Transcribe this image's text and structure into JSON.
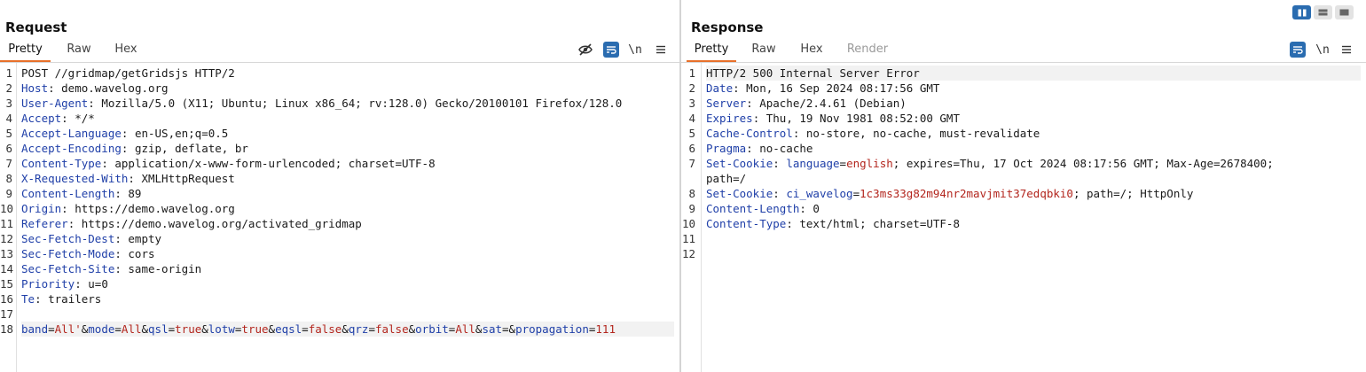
{
  "request": {
    "title": "Request",
    "tabs": [
      "Pretty",
      "Raw",
      "Hex"
    ],
    "active_tab": "Pretty",
    "toolbar": {
      "hide_icon": "eye-off-icon",
      "wrap_icon": "word-wrap-icon",
      "newline_label": "\\n",
      "menu_icon": "hamburger-menu-icon"
    },
    "lines": [
      {
        "n": "1",
        "text": "POST //gridmap/getGridsjs HTTP/2"
      },
      {
        "n": "2",
        "key": "Host",
        "val": " demo.wavelog.org"
      },
      {
        "n": "3",
        "key": "User-Agent",
        "val": " Mozilla/5.0 (X11; Ubuntu; Linux x86_64; rv:128.0) Gecko/20100101 Firefox/128.0"
      },
      {
        "n": "4",
        "key": "Accept",
        "val": " */*"
      },
      {
        "n": "5",
        "key": "Accept-Language",
        "val": " en-US,en;q=0.5"
      },
      {
        "n": "6",
        "key": "Accept-Encoding",
        "val": " gzip, deflate, br"
      },
      {
        "n": "7",
        "key": "Content-Type",
        "val": " application/x-www-form-urlencoded; charset=UTF-8"
      },
      {
        "n": "8",
        "key": "X-Requested-With",
        "val": " XMLHttpRequest"
      },
      {
        "n": "9",
        "key": "Content-Length",
        "val": " 89"
      },
      {
        "n": "10",
        "key": "Origin",
        "val": " https://demo.wavelog.org"
      },
      {
        "n": "11",
        "key": "Referer",
        "val": " https://demo.wavelog.org/activated_gridmap"
      },
      {
        "n": "12",
        "key": "Sec-Fetch-Dest",
        "val": " empty"
      },
      {
        "n": "13",
        "key": "Sec-Fetch-Mode",
        "val": " cors"
      },
      {
        "n": "14",
        "key": "Sec-Fetch-Site",
        "val": " same-origin"
      },
      {
        "n": "15",
        "key": "Priority",
        "val": " u=0"
      },
      {
        "n": "16",
        "key": "Te",
        "val": " trailers"
      },
      {
        "n": "17",
        "text": ""
      },
      {
        "n": "18",
        "highlight": true,
        "params": [
          {
            "k": "band",
            "v": "All'"
          },
          {
            "k": "mode",
            "v": "All"
          },
          {
            "k": "qsl",
            "v": "true"
          },
          {
            "k": "lotw",
            "v": "true"
          },
          {
            "k": "eqsl",
            "v": "false"
          },
          {
            "k": "qrz",
            "v": "false"
          },
          {
            "k": "orbit",
            "v": "All"
          },
          {
            "k": "sat",
            "v": ""
          },
          {
            "k": "propagation",
            "v": "111"
          }
        ]
      }
    ]
  },
  "response": {
    "title": "Response",
    "tabs": [
      "Pretty",
      "Raw",
      "Hex",
      "Render"
    ],
    "active_tab": "Pretty",
    "toolbar": {
      "wrap_icon": "word-wrap-icon",
      "newline_label": "\\n",
      "menu_icon": "hamburger-menu-icon"
    },
    "lines": [
      {
        "n": "1",
        "text": "HTTP/2 500 Internal Server Error",
        "highlight": true
      },
      {
        "n": "2",
        "key": "Date",
        "val": " Mon, 16 Sep 2024 08:17:56 GMT"
      },
      {
        "n": "3",
        "key": "Server",
        "val": " Apache/2.4.61 (Debian)"
      },
      {
        "n": "4",
        "key": "Expires",
        "val": " Thu, 19 Nov 1981 08:52:00 GMT"
      },
      {
        "n": "5",
        "key": "Cache-Control",
        "val": " no-store, no-cache, must-revalidate"
      },
      {
        "n": "6",
        "key": "Pragma",
        "val": " no-cache"
      },
      {
        "n": "7",
        "key": "Set-Cookie",
        "cookie_name": "language",
        "cookie_val": "english",
        "rest": "; expires=Thu, 17 Oct 2024 08:17:56 GMT; Max-Age=2678400;"
      },
      {
        "n": "",
        "text": "path=/"
      },
      {
        "n": "8",
        "key": "Set-Cookie",
        "cookie_name": "ci_wavelog",
        "cookie_val": "1c3ms33g82m94nr2mavjmit37edqbki0",
        "rest": "; path=/; HttpOnly"
      },
      {
        "n": "9",
        "key": "Content-Length",
        "val": " 0"
      },
      {
        "n": "10",
        "key": "Content-Type",
        "val": " text/html; charset=UTF-8"
      },
      {
        "n": "11",
        "text": ""
      },
      {
        "n": "12",
        "text": ""
      }
    ]
  },
  "layout_buttons": [
    {
      "name": "side-by-side-layout-icon",
      "active": true
    },
    {
      "name": "top-bottom-layout-icon",
      "active": false
    },
    {
      "name": "single-pane-layout-icon",
      "active": false
    }
  ],
  "colors": {
    "accent": "#e8702a",
    "key": "#1f3fa8",
    "value": "#b3261e",
    "tool_blue": "#2a6cb0"
  }
}
